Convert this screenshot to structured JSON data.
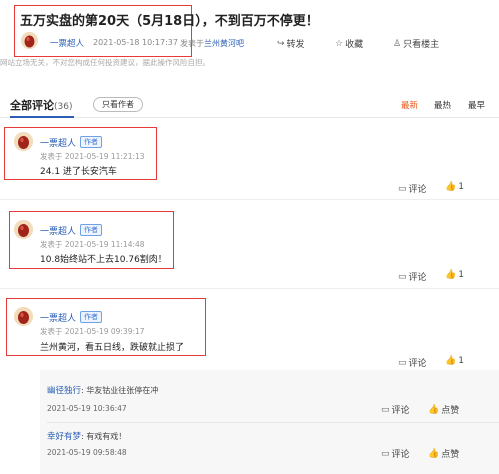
{
  "post": {
    "title": "五万实盘的第20天（5月18日），不到百万不停更！",
    "author": "一票超人",
    "time": "2021-05-18 10:17:37",
    "published_in_label": "发表于",
    "forum": "兰州黄河吧",
    "actions": {
      "share": "转发",
      "fav": "收藏",
      "only_host": "只看楼主"
    },
    "disclaimer": "网站立场无关，不对您构成任何投资建议，据此操作风险自担。"
  },
  "comments_header": {
    "title": "全部评论",
    "count": "(36)",
    "only_author": "只看作者",
    "sort_latest": "最新",
    "sort_hot": "最热",
    "sort_oldest": "最早"
  },
  "comments": [
    {
      "user": "一票超人",
      "badge": "作者",
      "time": "发表于 2021-05-19 11:21:13",
      "text": "24.1 进了长安汽车",
      "reply": "评论",
      "likes": "1"
    },
    {
      "user": "一票超人",
      "badge": "作者",
      "time": "发表于 2021-05-19 11:14:48",
      "text": "10.8始终站不上去10.76割肉！",
      "reply": "评论",
      "likes": "1"
    },
    {
      "user": "一票超人",
      "badge": "作者",
      "time": "发表于 2021-05-19 09:39:17",
      "text": "兰州黄河，看五日线，跌破就止损了",
      "reply": "评论",
      "likes": "1"
    }
  ],
  "replies": [
    {
      "user": "幽径独行",
      "text": "华友钴业往张停在冲",
      "time": "2021-05-19 10:36:47",
      "reply": "评论",
      "like": "点赞"
    },
    {
      "user": "幸好有梦",
      "text": "有戏有戏！",
      "time": "2021-05-19 09:58:48",
      "reply": "评论",
      "like": "点赞"
    }
  ],
  "colors": {
    "link": "#2b5fb3",
    "accent": "#e8581c",
    "highlight": "#e63a3a"
  }
}
